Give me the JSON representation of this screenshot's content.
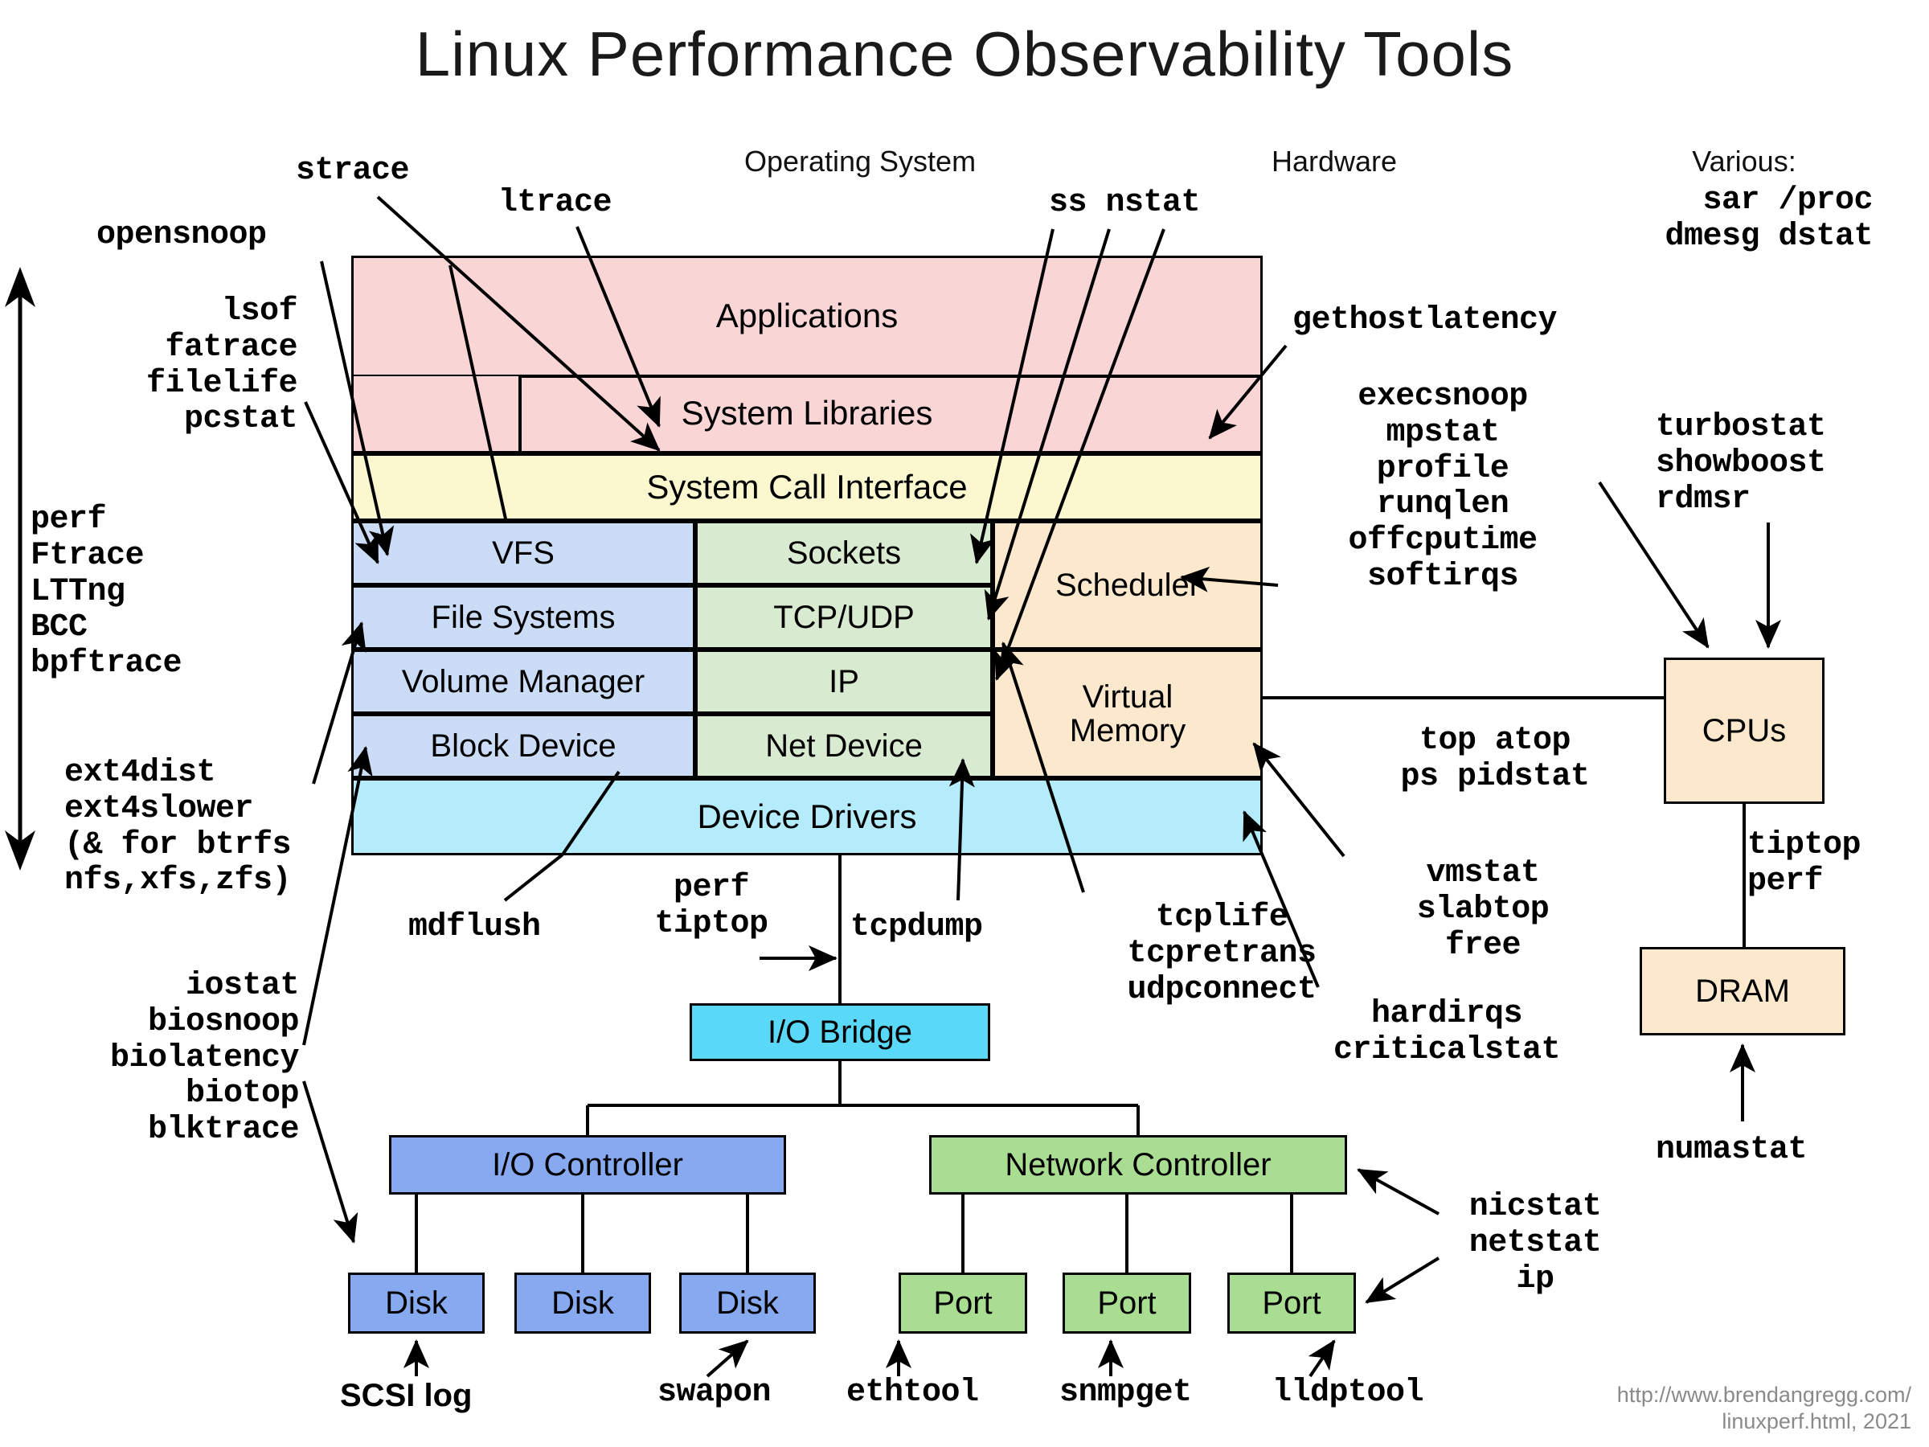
{
  "title": "Linux Performance Observability Tools",
  "credit": "http://www.brendangregg.com/\nlinuxperf.html, 2021",
  "colors": {
    "applications": "#fad5d6",
    "syscall": "#fbf8d0",
    "storage": "#cbdcf7",
    "network": "#d8ead0",
    "cpu_memory": "#fbe8cd",
    "device_drivers": "#b5ecfb",
    "io_bridge": "#59d8f7",
    "io_controller": "#86a9f0",
    "disk": "#86a9f0",
    "network_controller": "#a8dd92",
    "port": "#a8dd92",
    "hardware": "#fbe8cd",
    "credit_text": "#8a8a8a",
    "outline": "#000000"
  },
  "section_headers": [
    {
      "label": "Operating System"
    },
    {
      "label": "Hardware"
    },
    {
      "label": "Various:"
    }
  ],
  "os_stack": {
    "applications": "Applications",
    "system_libraries": "System Libraries",
    "system_call_interface": "System Call Interface",
    "storage_column": [
      "VFS",
      "File Systems",
      "Volume Manager",
      "Block Device"
    ],
    "network_column": [
      "Sockets",
      "TCP/UDP",
      "IP",
      "Net Device"
    ],
    "cpu_memory_column": [
      "Scheduler",
      "Virtual\nMemory"
    ],
    "device_drivers": "Device Drivers"
  },
  "hardware": {
    "io_bridge": "I/O Bridge",
    "io_controller": "I/O Controller",
    "network_controller": "Network Controller",
    "disks": [
      "Disk",
      "Disk",
      "Disk"
    ],
    "ports": [
      "Port",
      "Port",
      "Port"
    ],
    "cpus": "CPUs",
    "dram": "DRAM"
  },
  "tool_labels": {
    "strace": "strace",
    "ltrace": "ltrace",
    "opensnoop": "opensnoop",
    "file_tools": "lsof\nfatrace\nfilelife\npcstat",
    "tracers": "perf\nFtrace\nLTTng\nBCC\nbpftrace",
    "ext4_tools": "ext4dist\next4slower\n(& for btrfs\nnfs,xfs,zfs)",
    "block_tools": "iostat\nbiosnoop\nbiolatency\nbiotop\nblktrace",
    "ss_nstat": "ss nstat",
    "various": "sar /proc\ndmesg dstat",
    "gethostlatency": "gethostlatency",
    "cpu_tools": "execsnoop\nmpstat\nprofile\nrunqlen\noffcputime\nsoftirqs",
    "turbostat_group": "turbostat\nshowboost\nrdmsr",
    "top_group": "top atop\nps pidstat",
    "mem_tools": "vmstat\nslabtop\nfree",
    "irq_tools": "hardirqs\ncriticalstat",
    "tcp_tools": "tcplife\ntcpretrans\nudpconnect",
    "tcpdump": "tcpdump",
    "mdflush": "mdflush",
    "perf_tiptop": "perf\ntiptop",
    "tiptop_perf_dram": "tiptop\nperf",
    "numastat": "numastat",
    "nicstat_group": "nicstat\nnetstat\nip",
    "scsi_log": "SCSI log",
    "swapon": "swapon",
    "ethtool": "ethtool",
    "snmpget": "snmpget",
    "lldptool": "lldptool"
  }
}
